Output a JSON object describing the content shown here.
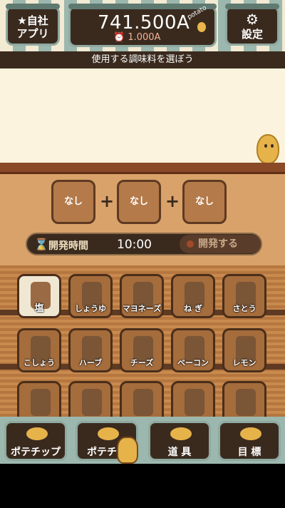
{
  "header": {
    "app_button_line1": "★自社",
    "app_button_line2": "アプリ",
    "money": "741.500A",
    "income": "⏰ 1.000A",
    "potato_tag": "potato",
    "settings_icon": "gear-icon",
    "settings_label": "設定"
  },
  "instruction": "使用する調味料を選ぼう",
  "combine": {
    "slots": [
      "なし",
      "なし",
      "なし"
    ],
    "plus": "+",
    "dev_label": "開発時間",
    "dev_time": "10:00",
    "dev_button": "開発する"
  },
  "ingredients": [
    {
      "label": "塩"
    },
    {
      "label": "しょうゆ"
    },
    {
      "label": "マヨネーズ"
    },
    {
      "label": "ね ぎ"
    },
    {
      "label": "さとう"
    },
    {
      "label": "こしょう"
    },
    {
      "label": "ハーブ"
    },
    {
      "label": "チーズ"
    },
    {
      "label": "ベーコン"
    },
    {
      "label": "レモン"
    },
    {
      "label": ""
    },
    {
      "label": ""
    },
    {
      "label": ""
    },
    {
      "label": ""
    },
    {
      "label": ""
    }
  ],
  "tabs": [
    {
      "label": "ポテチップ"
    },
    {
      "label": "ポテチ開"
    },
    {
      "label": "道 具"
    },
    {
      "label": "目 標"
    }
  ]
}
